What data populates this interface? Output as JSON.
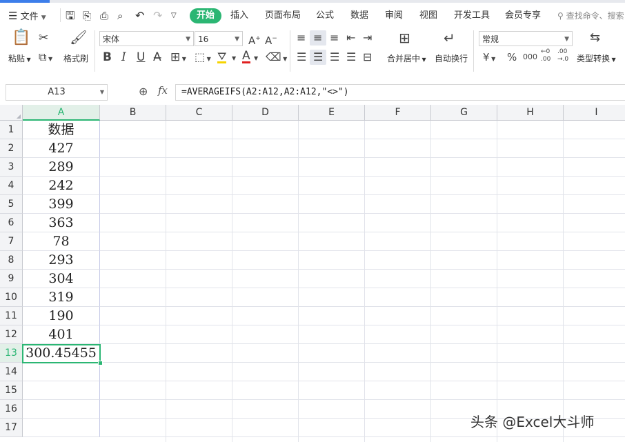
{
  "menu": {
    "file": "文件",
    "tabs": [
      "开始",
      "插入",
      "页面布局",
      "公式",
      "数据",
      "审阅",
      "视图",
      "开发工具",
      "会员专享"
    ],
    "search_placeholder": "查找命令、搜索"
  },
  "ribbon": {
    "paste": "粘贴",
    "format_painter": "格式刷",
    "font_name": "宋体",
    "font_size": "16",
    "merge_center": "合并居中",
    "wrap_text": "自动换行",
    "number_format": "常规",
    "type_convert": "类型转换",
    "currency_symbol": "¥",
    "percent_symbol": "%",
    "thousands_symbol": "000"
  },
  "formula_bar": {
    "name_box": "A13",
    "fx_label": "fx",
    "formula": "=AVERAGEIFS(A2:A12,A2:A12,\"<>\")"
  },
  "sheet": {
    "columns": [
      "A",
      "B",
      "C",
      "D",
      "E",
      "F",
      "G",
      "H",
      "I"
    ],
    "rows": [
      "1",
      "2",
      "3",
      "4",
      "5",
      "6",
      "7",
      "8",
      "9",
      "10",
      "11",
      "12",
      "13",
      "14",
      "15",
      "16",
      "17"
    ],
    "colA": [
      "数据",
      "427",
      "289",
      "242",
      "399",
      "363",
      "78",
      "293",
      "304",
      "319",
      "190",
      "401",
      "300.45455",
      "",
      "",
      "",
      ""
    ],
    "active_cell": "A13"
  },
  "watermark": "头条 @Excel大斗师",
  "colors": {
    "accent": "#2bb673",
    "selection": "#2bb673",
    "tab_blue": "#3d7eea"
  }
}
